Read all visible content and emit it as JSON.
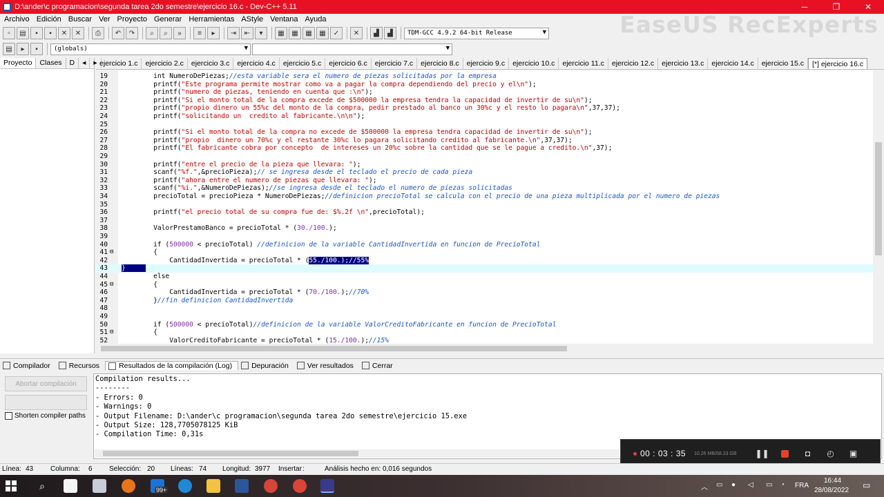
{
  "window": {
    "title": "D:\\ander\\c programacion\\segunda tarea 2do semestre\\ejercicio 16.c - Dev-C++ 5.11",
    "minimize": "─",
    "maximize": "❐",
    "close": "✕"
  },
  "watermark": "EaseUS RecExperts",
  "menu": [
    "Archivo",
    "Edición",
    "Buscar",
    "Ver",
    "Proyecto",
    "Generar",
    "Herramientas",
    "AStyle",
    "Ventana",
    "Ayuda"
  ],
  "toolbar": {
    "compiler_select": "TDM-GCC 4.9.2 64-bit Release",
    "scope_select": "(globals)",
    "function_select": ""
  },
  "left_tabs": [
    "Proyecto",
    "Clases",
    "D"
  ],
  "file_tabs": [
    "ejercicio 1.c",
    "ejercicio 2.c",
    "ejercicio 3.c",
    "ejercicio 4.c",
    "ejercicio 5.c",
    "ejercicio 6.c",
    "ejercicio 7.c",
    "ejercicio 8.c",
    "ejercicio 9.c",
    "ejercicio 10.c",
    "ejercicio 11.c",
    "ejercicio 12.c",
    "ejercicio 13.c",
    "ejercicio 14.c",
    "ejercicio 15.c",
    "[*] ejercicio 16.c"
  ],
  "code": [
    {
      "n": "19",
      "segs": [
        {
          "t": "    int NumeroDePiezas;",
          "c": ""
        },
        {
          "t": "//esta variable sera el numero de piezas solicitadas por la empresa",
          "c": "cm"
        }
      ]
    },
    {
      "n": "20",
      "segs": [
        {
          "t": "    printf(",
          "c": ""
        },
        {
          "t": "\"Este programa permite mostrar como va a pagar la compra dependiendo del precio y el\\n\"",
          "c": "st"
        },
        {
          "t": ");",
          "c": ""
        }
      ]
    },
    {
      "n": "21",
      "segs": [
        {
          "t": "    printf(",
          "c": ""
        },
        {
          "t": "\"numero de piezas, teniendo en cuenta que :\\n\"",
          "c": "st"
        },
        {
          "t": ");",
          "c": ""
        }
      ]
    },
    {
      "n": "22",
      "segs": [
        {
          "t": "    printf(",
          "c": ""
        },
        {
          "t": "\"Si el monto total de la compra excede de $500000 la empresa tendra la capacidad de invertir de su\\n\"",
          "c": "st"
        },
        {
          "t": ");",
          "c": ""
        }
      ]
    },
    {
      "n": "23",
      "segs": [
        {
          "t": "    printf(",
          "c": ""
        },
        {
          "t": "\"propio dinero un 55%c del monto de la compra, pedir prestado al banco un 30%c y el resto lo pagara\\n\"",
          "c": "st"
        },
        {
          "t": ",37,37);",
          "c": ""
        }
      ]
    },
    {
      "n": "24",
      "segs": [
        {
          "t": "    printf(",
          "c": ""
        },
        {
          "t": "\"solicitando un  credito al fabricante.\\n\\n\"",
          "c": "st"
        },
        {
          "t": ");",
          "c": ""
        }
      ]
    },
    {
      "n": "25",
      "segs": []
    },
    {
      "n": "26",
      "segs": [
        {
          "t": "    printf(",
          "c": ""
        },
        {
          "t": "\"Si el monto total de la compra no excede de $500000 la empresa tendra capacidad de invertir de su\\n\"",
          "c": "st"
        },
        {
          "t": ");",
          "c": ""
        }
      ]
    },
    {
      "n": "27",
      "segs": [
        {
          "t": "    printf(",
          "c": ""
        },
        {
          "t": "\"propio  dinero un 70%c y el restante 30%c lo pagara solicitando credito al fabricante.\\n\"",
          "c": "st"
        },
        {
          "t": ",37,37);",
          "c": ""
        }
      ]
    },
    {
      "n": "28",
      "segs": [
        {
          "t": "    printf(",
          "c": ""
        },
        {
          "t": "\"El fabricante cobra por concepto  de intereses un 20%c sobre la cantidad que se le pague a credito.\\n\"",
          "c": "st"
        },
        {
          "t": ",37);",
          "c": ""
        }
      ]
    },
    {
      "n": "29",
      "segs": []
    },
    {
      "n": "30",
      "segs": [
        {
          "t": "    printf(",
          "c": ""
        },
        {
          "t": "\"entre el precio de la pieza que llevara: \"",
          "c": "st"
        },
        {
          "t": ");",
          "c": ""
        }
      ]
    },
    {
      "n": "31",
      "segs": [
        {
          "t": "    scanf(",
          "c": ""
        },
        {
          "t": "\"%f.\"",
          "c": "st"
        },
        {
          "t": ",&precioPieza);",
          "c": ""
        },
        {
          "t": "// se ingresa desde el teclado el precio de cada pieza",
          "c": "cm"
        }
      ]
    },
    {
      "n": "32",
      "segs": [
        {
          "t": "    printf(",
          "c": ""
        },
        {
          "t": "\"ahora entre el numero de piezas que llevara: \"",
          "c": "st"
        },
        {
          "t": ");",
          "c": ""
        }
      ]
    },
    {
      "n": "33",
      "segs": [
        {
          "t": "    scanf(",
          "c": ""
        },
        {
          "t": "\"%i.\"",
          "c": "st"
        },
        {
          "t": ",&NumeroDePiezas);",
          "c": ""
        },
        {
          "t": "//se ingresa desde el teclado el numero de piezas solicitadas",
          "c": "cm"
        }
      ]
    },
    {
      "n": "34",
      "segs": [
        {
          "t": "    precioTotal = precioPieza * NumeroDePiezas;",
          "c": ""
        },
        {
          "t": "//definicion precioTotal se calcula con el precio de una pieza multiplicada por el numero de piezas",
          "c": "cm"
        }
      ]
    },
    {
      "n": "35",
      "segs": []
    },
    {
      "n": "36",
      "segs": [
        {
          "t": "    printf(",
          "c": ""
        },
        {
          "t": "\"el precio total de su compra fue de: $%.2f \\n\"",
          "c": "st"
        },
        {
          "t": ",precioTotal);",
          "c": ""
        }
      ]
    },
    {
      "n": "37",
      "segs": []
    },
    {
      "n": "38",
      "segs": [
        {
          "t": "    ValorPrestamoBanco = precioTotal * (",
          "c": ""
        },
        {
          "t": "30./100.",
          "c": "nm"
        },
        {
          "t": ");",
          "c": ""
        }
      ]
    },
    {
      "n": "39",
      "segs": []
    },
    {
      "n": "40",
      "segs": [
        {
          "t": "    if (",
          "c": ""
        },
        {
          "t": "500000",
          "c": "nm"
        },
        {
          "t": " < precioTotal) ",
          "c": ""
        },
        {
          "t": "//definicion de la variable CantidadInvertida en funcion de PrecioTotal",
          "c": "cm"
        }
      ]
    },
    {
      "n": "41",
      "segs": [
        {
          "t": "    {",
          "c": ""
        }
      ]
    },
    {
      "n": "42",
      "segs": [
        {
          "t": "        CantidadInvertida = precioTotal * (",
          "c": ""
        },
        {
          "t": "55./100.);//55%",
          "c": "hl"
        }
      ]
    },
    {
      "n": "43",
      "segs": [
        {
          "t": "}",
          "c": "hl"
        }
      ]
    },
    {
      "n": "44",
      "segs": [
        {
          "t": "    else",
          "c": ""
        }
      ]
    },
    {
      "n": "45",
      "segs": [
        {
          "t": "    {",
          "c": ""
        }
      ]
    },
    {
      "n": "46",
      "segs": [
        {
          "t": "        CantidadInvertida = precioTotal * (",
          "c": ""
        },
        {
          "t": "70./100.",
          "c": "nm"
        },
        {
          "t": ");",
          "c": ""
        },
        {
          "t": "//70%",
          "c": "cm"
        }
      ]
    },
    {
      "n": "47",
      "segs": [
        {
          "t": "    }",
          "c": ""
        },
        {
          "t": "//fin definicion CantidadInvertida",
          "c": "cm"
        }
      ]
    },
    {
      "n": "48",
      "segs": []
    },
    {
      "n": "49",
      "segs": []
    },
    {
      "n": "50",
      "segs": [
        {
          "t": "    if (",
          "c": ""
        },
        {
          "t": "500000",
          "c": "nm"
        },
        {
          "t": " < precioTotal)",
          "c": ""
        },
        {
          "t": "//definicion de la variable ValorCreditoFabricante en funcion de PrecioTotal",
          "c": "cm"
        }
      ]
    },
    {
      "n": "51",
      "segs": [
        {
          "t": "    {",
          "c": ""
        }
      ]
    },
    {
      "n": "52",
      "segs": [
        {
          "t": "        ValorCreditoFabricante = precioTotal * (",
          "c": ""
        },
        {
          "t": "15./100.",
          "c": "nm"
        },
        {
          "t": ");",
          "c": ""
        },
        {
          "t": "//15%",
          "c": "cm"
        }
      ]
    }
  ],
  "bottom_tabs": [
    "Compilador",
    "Recursos",
    "Resultados de la compilación (Log)",
    "Depuración",
    "Ver resultados",
    "Cerrar"
  ],
  "bottom_panel": {
    "abort_button": "Abortar compilación",
    "shorten_paths": "Shorten compiler paths"
  },
  "log_lines": [
    "Compilation results...",
    "--------",
    "- Errors: 0",
    "- Warnings: 0",
    "- Output Filename: D:\\ander\\c programacion\\segunda tarea 2do semestre\\ejercicio 15.exe",
    "- Output Size: 128,7705078125 KiB",
    "- Compilation Time: 0,31s"
  ],
  "recorder": {
    "time": "00 : 03 : 35",
    "size": "10.26 MB/68.33 GB"
  },
  "status": {
    "line_label": "Línea:",
    "line": "43",
    "col_label": "Columna:",
    "col": "6",
    "sel_label": "Selección:",
    "sel": "20",
    "lines_label": "Líneas:",
    "lines": "74",
    "len_label": "Longitud:",
    "len": "3977",
    "mode": "Insertar",
    "analysis": "Análisis hecho en: 0,016 segundos"
  },
  "taskbar": {
    "mail_badge": "99+",
    "lang": "FRA",
    "time": "16:44",
    "date": "28/08/2022"
  },
  "colors": {
    "titlebar": "#e81123",
    "selection": "#000080",
    "string": "#c00000",
    "comment": "#1a56c8",
    "number": "#7a2ea8"
  }
}
